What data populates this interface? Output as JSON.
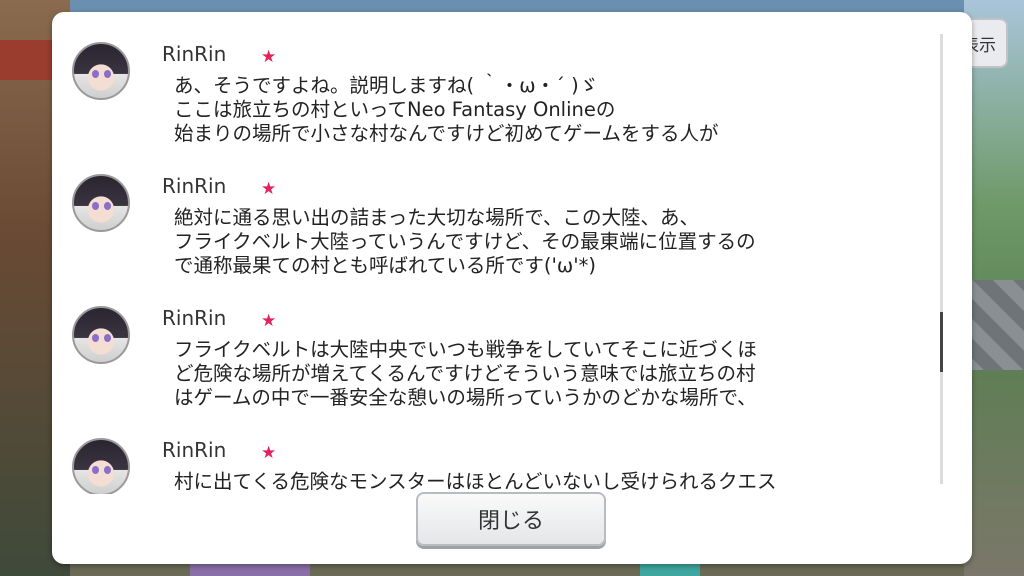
{
  "top_right": {
    "display_label": "表示"
  },
  "log": {
    "entries": [
      {
        "name": "RinRin",
        "text": "あ、そうですよね。説明しますね( ｀・ω・´ )ゞ\nここは旅立ちの村といってNeo Fantasy Onlineの\n始まりの場所で小さな村なんですけど初めてゲームをする人が"
      },
      {
        "name": "RinRin",
        "text": "絶対に通る思い出の詰まった大切な場所で、この大陸、あ、\nフライクベルト大陸っていうんですけど、その最東端に位置するの\nで通称最果ての村とも呼ばれている所です('ω'*)"
      },
      {
        "name": "RinRin",
        "text": "フライクベルトは大陸中央でいつも戦争をしていてそこに近づくほ\nど危険な場所が増えてくるんですけどそういう意味では旅立ちの村\nはゲームの中で一番安全な憩いの場所っていうかのどかな場所で、"
      },
      {
        "name": "RinRin",
        "text": "村に出てくる危険なモンスターはほとんどいないし受けられるクエス"
      }
    ],
    "scroll_fraction": 0.62
  },
  "close_button": {
    "label": "閉じる"
  },
  "colors": {
    "star": "#e0245e",
    "dialog_bg": "#ffffff"
  }
}
